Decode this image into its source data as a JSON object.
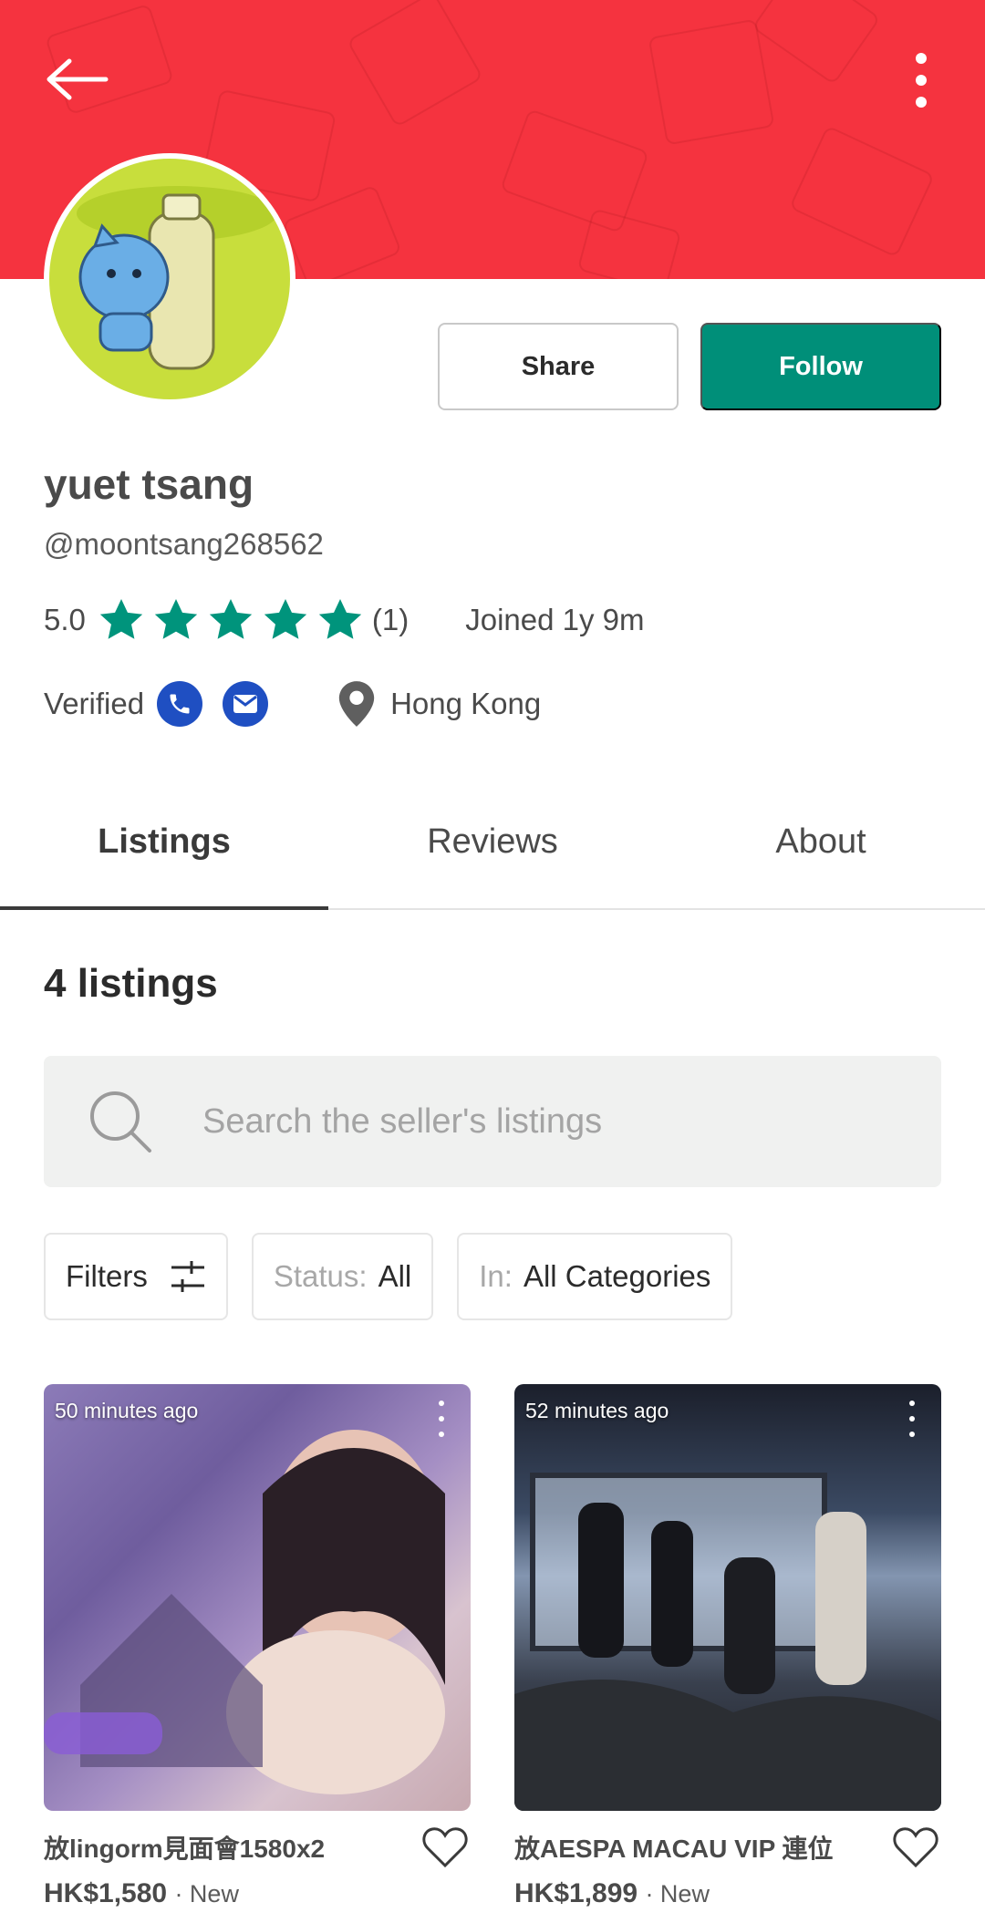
{
  "header": {
    "back_icon": "arrow-left-icon",
    "more_icon": "more-vertical-icon",
    "banner_color": "#f5333f"
  },
  "profile": {
    "display_name": "yuet tsang",
    "username": "@moontsang268562",
    "rating": "5.0",
    "stars": 5,
    "review_count": "(1)",
    "joined": "Joined 1y 9m",
    "verified_label": "Verified",
    "location": "Hong Kong"
  },
  "actions": {
    "share_label": "Share",
    "follow_label": "Follow",
    "accent_color": "#008f79"
  },
  "tabs": [
    {
      "label": "Listings",
      "active": true
    },
    {
      "label": "Reviews",
      "active": false
    },
    {
      "label": "About",
      "active": false
    }
  ],
  "listings": {
    "count_label": "4 listings",
    "search_placeholder": "Search the seller's listings",
    "filters_label": "Filters",
    "status_prefix": "Status:",
    "status_value": "All",
    "category_prefix": "In:",
    "category_value": "All Categories"
  },
  "cards": [
    {
      "time": "50 minutes ago",
      "title": "放lingorm見面會1580x2",
      "price": "HK$1,580",
      "condition": "· New"
    },
    {
      "time": "52 minutes ago",
      "title": "放AESPA MACAU VIP 連位",
      "price": "HK$1,899",
      "condition": "· New"
    }
  ]
}
